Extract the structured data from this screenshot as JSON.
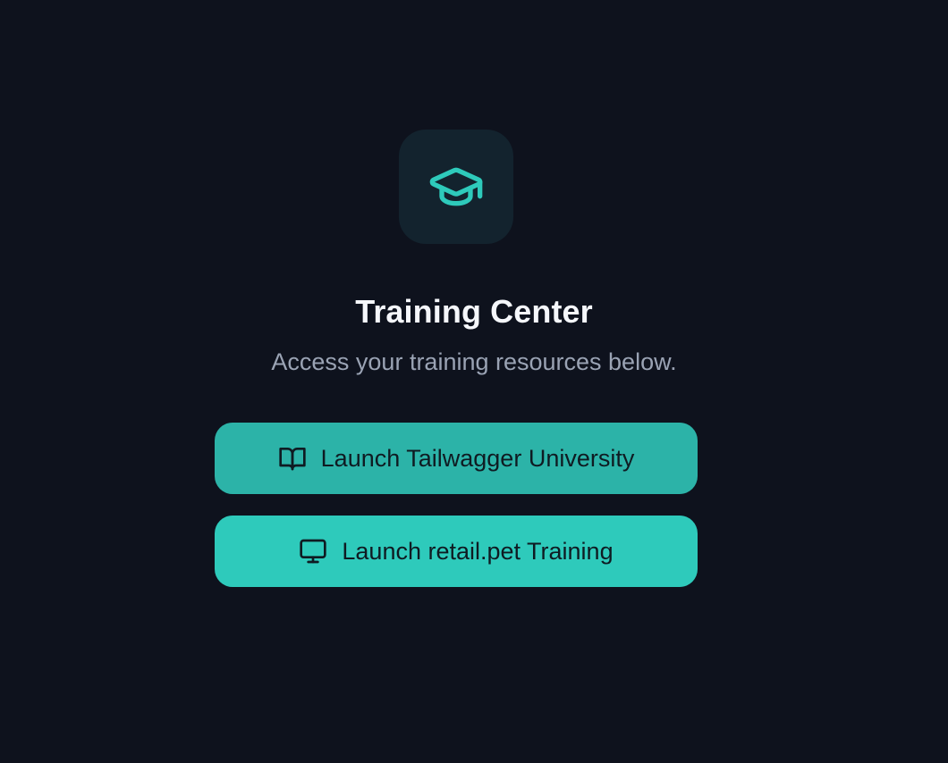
{
  "header": {
    "icon": "graduation-cap-icon",
    "title": "Training Center",
    "subtitle": "Access your training resources below."
  },
  "actions": [
    {
      "label": "Launch Tailwagger University",
      "icon": "book-open-icon"
    },
    {
      "label": "Launch retail.pet Training",
      "icon": "monitor-icon"
    }
  ],
  "colors": {
    "background": "#0e121d",
    "accent": "#2ecabb",
    "accent_dim": "#2cb3a8",
    "icon_tile": "#13232e"
  }
}
